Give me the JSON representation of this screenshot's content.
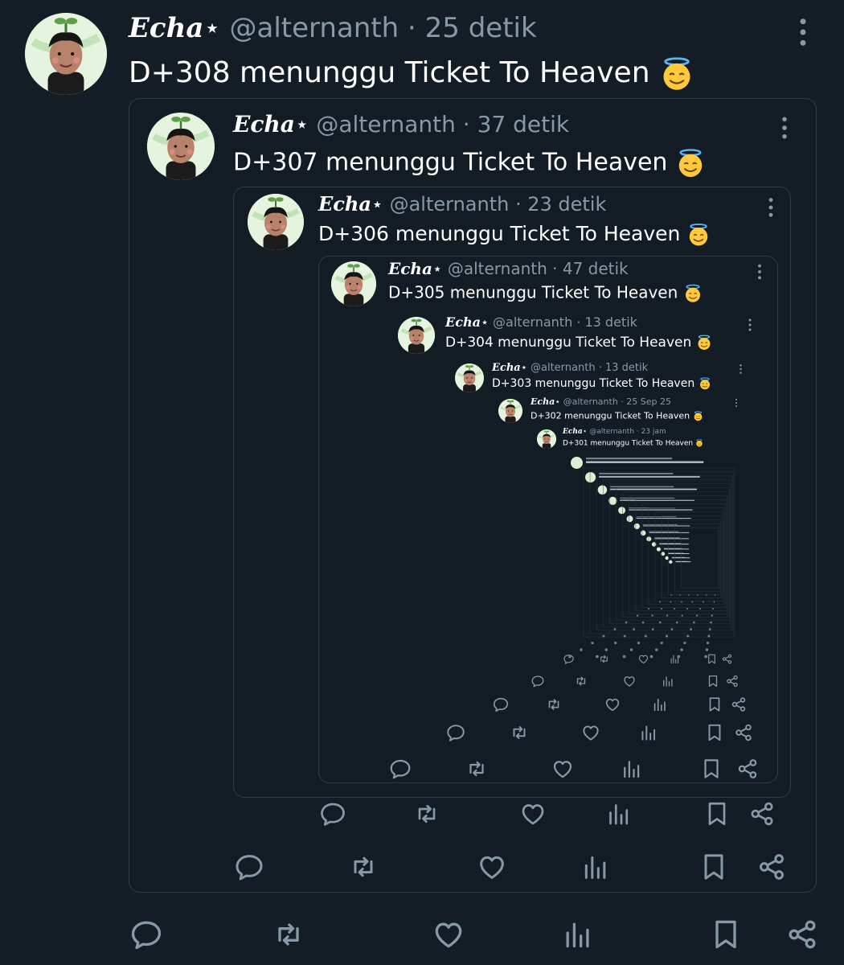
{
  "colors": {
    "background": "#141d26",
    "text": "#ffffff",
    "muted": "#8899a6",
    "frame": "#2f3b45"
  },
  "icons": [
    "reply-icon",
    "retweet-icon",
    "like-icon",
    "views-icon",
    "bookmark-icon",
    "share-icon",
    "more-icon",
    "halo-smile-emoji"
  ],
  "posts": [
    {
      "name": "Echa",
      "star": "⋆",
      "handle": "@alternanth",
      "time": "· 25 detik",
      "text": "D+308 menunggu Ticket To Heaven"
    },
    {
      "name": "Echa",
      "star": "⋆",
      "handle": "@alternanth",
      "time": "· 37 detik",
      "text": "D+307 menunggu Ticket To Heaven"
    },
    {
      "name": "Echa",
      "star": "⋆",
      "handle": "@alternanth",
      "time": "· 23 detik",
      "text": "D+306 menunggu Ticket To Heaven"
    },
    {
      "name": "Echa",
      "star": "⋆",
      "handle": "@alternanth",
      "time": "· 47 detik",
      "text": "D+305 menunggu Ticket To Heaven"
    },
    {
      "name": "Echa",
      "star": "⋆",
      "handle": "@alternanth",
      "time": "· 13 detik",
      "text": "D+304 menunggu Ticket To Heaven"
    },
    {
      "name": "Echa",
      "star": "⋆",
      "handle": "@alternanth",
      "time": "· 13 detik",
      "text": "D+303 menunggu Ticket To Heaven"
    },
    {
      "name": "Echa",
      "star": "⋆",
      "handle": "@alternanth",
      "time": "· 25 Sep 25",
      "text": "D+302 menunggu Ticket To Heaven"
    },
    {
      "name": "Echa",
      "star": "⋆",
      "handle": "@alternanth",
      "time": "· 23 jam",
      "text": "D+301 menunggu Ticket To Heaven"
    }
  ]
}
